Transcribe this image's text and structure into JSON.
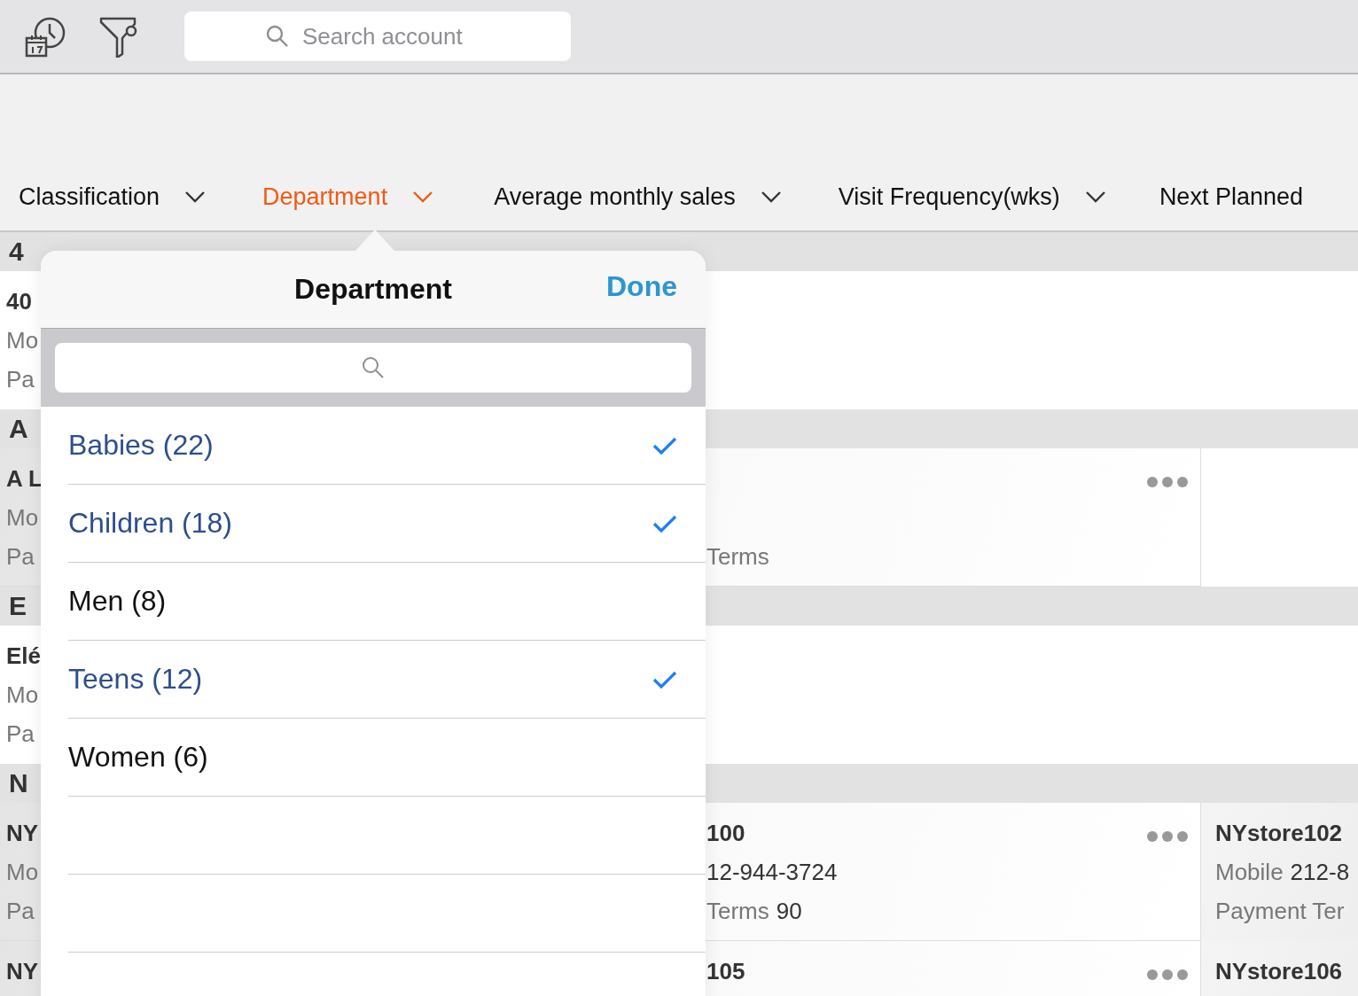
{
  "toolbar": {
    "search": {
      "placeholder": "Search account"
    }
  },
  "columns": [
    {
      "label": "Classification",
      "selected": false
    },
    {
      "label": "Department",
      "selected": true
    },
    {
      "label": "Average monthly sales",
      "selected": false
    },
    {
      "label": "Visit Frequency(wks)",
      "selected": false
    },
    {
      "label": "Next Planned",
      "selected": false
    }
  ],
  "sections": [
    {
      "header": "4",
      "rows": [
        {
          "stub": [
            "40",
            "Mo",
            "Pa"
          ],
          "more": false
        }
      ]
    },
    {
      "header": "A",
      "rows": [
        {
          "stub": [
            "A L",
            "Mo",
            "Pa"
          ],
          "more": true,
          "payment_tail": "Terms"
        }
      ]
    },
    {
      "header": "E",
      "rows": [
        {
          "stub": [
            "Elé",
            "Mo",
            "Pa"
          ],
          "more": false
        }
      ]
    },
    {
      "header": "N",
      "rows": [
        {
          "stub": [
            "NY",
            "Mo",
            "Pa"
          ],
          "more": true,
          "name_tail": "100",
          "mobile_tail": "12-944-3724",
          "payment_tail": "Terms",
          "payment_value": "90",
          "right": {
            "name": "NYstore102",
            "mobile_label": "Mobile",
            "mobile_value": "212-8",
            "payment_label": "Payment Ter"
          }
        },
        {
          "stub": [
            "NY"
          ],
          "more": true,
          "name_tail": "105",
          "right": {
            "name": "NYstore106"
          }
        }
      ]
    }
  ],
  "popover": {
    "title": "Department",
    "done": "Done",
    "items": [
      {
        "label": "Babies",
        "count": "(22)",
        "checked": true
      },
      {
        "label": "Children",
        "count": "(18)",
        "checked": true
      },
      {
        "label": "Men",
        "count": "(8)",
        "checked": false
      },
      {
        "label": "Teens",
        "count": "(12)",
        "checked": true
      },
      {
        "label": "Women",
        "count": "(6)",
        "checked": false
      }
    ]
  }
}
